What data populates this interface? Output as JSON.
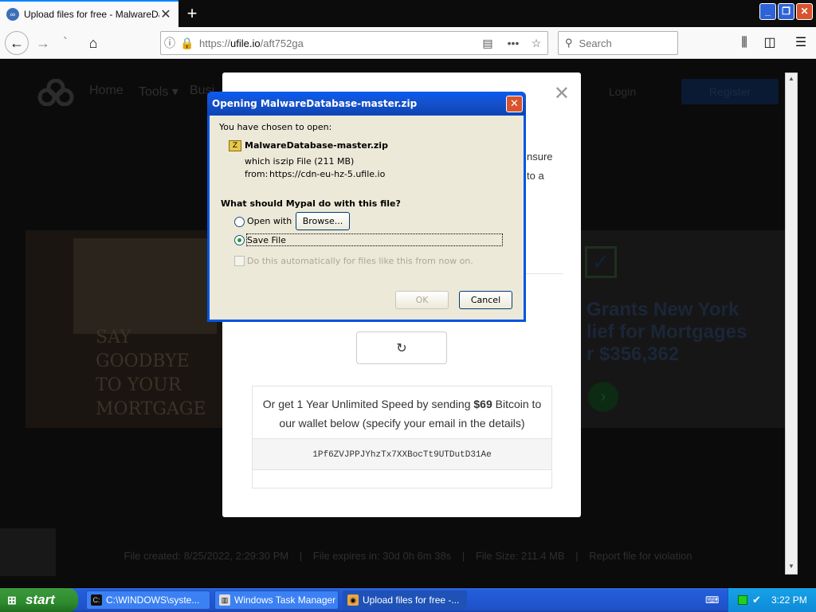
{
  "browser": {
    "tab_title": "Upload files for free - MalwareDat",
    "tab_close": "✕",
    "new_tab": "+",
    "url_prefix": "https://",
    "url_host": "ufile.io",
    "url_path": "/aft752ga",
    "search_placeholder": "Search"
  },
  "site": {
    "nav_home": "Home",
    "nav_tools": "Tools ▾",
    "nav_business": "Busi",
    "login": "Login",
    "register": "Register",
    "ad_left_sign": "SAY GOODBYE TO YOUR MORTGAGE",
    "ad_right_line1": "Grants New York",
    "ad_right_line2": "lief for Mortgages",
    "ad_right_line3": "r $356,362",
    "footer_created": "File created: 8/25/2022, 2:29:30 PM",
    "footer_expires": "File expires in: 30d 0h 6m 38s",
    "footer_size": "File Size: 211.4 MB",
    "footer_report": "Report file for violation"
  },
  "modal": {
    "close": "✕",
    "frag1": "nsure",
    "frag2": "to a",
    "spin_icon": "↻",
    "btc_text_pre": "Or get 1 Year Unlimited Speed by sending ",
    "btc_amount": "$69",
    "btc_text_post": " Bitcoin to our wallet below (specify your email in the details)",
    "btc_address": "1Pf6ZVJPPJYhzTx7XXBocTt9UTDutD31Ae"
  },
  "dialog": {
    "title": "Opening MalwareDatabase-master.zip",
    "close": "✕",
    "chosen": "You have chosen to open:",
    "file_name": "MalwareDatabase-master.zip",
    "which_label": "which is:",
    "which_value": "zip File (211 MB)",
    "from_label": "from:",
    "from_value": "https://cdn-eu-hz-5.ufile.io",
    "question": "What should Mypal do with this file?",
    "open_with": "Open with",
    "browse": "Browse...",
    "save_file": "Save File",
    "auto": "Do this automatically for files like this from now on.",
    "ok": "OK",
    "cancel": "Cancel"
  },
  "taskbar": {
    "start": "start",
    "task1": "C:\\WINDOWS\\syste...",
    "task2": "Windows Task Manager",
    "task3": "Upload files for free -...",
    "clock": "3:22 PM"
  }
}
